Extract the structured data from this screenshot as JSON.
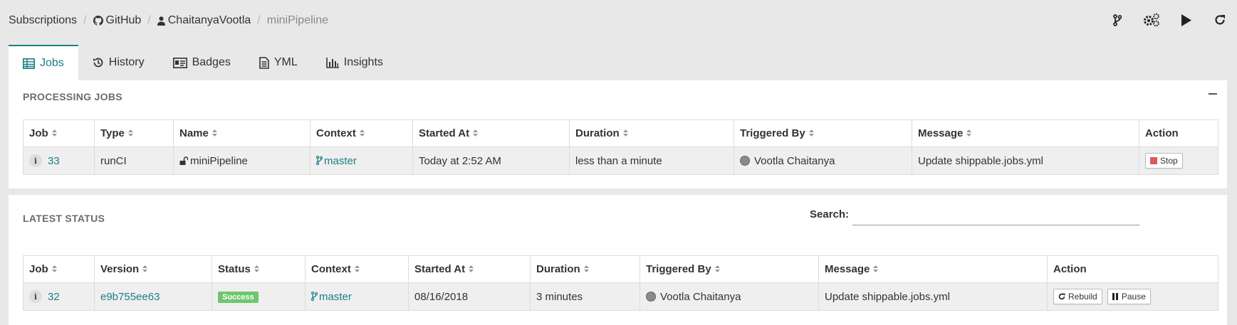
{
  "breadcrumb": {
    "items": [
      "Subscriptions",
      "GitHub",
      "ChaitanyaVootla",
      "miniPipeline"
    ],
    "separator": "/"
  },
  "top_actions": [
    "branch-icon",
    "settings-icon",
    "play-icon",
    "refresh-icon"
  ],
  "tabs": [
    {
      "label": "Jobs",
      "icon": "table-icon",
      "active": true
    },
    {
      "label": "History",
      "icon": "history-icon"
    },
    {
      "label": "Badges",
      "icon": "id-card-icon"
    },
    {
      "label": "YML",
      "icon": "file-icon"
    },
    {
      "label": "Insights",
      "icon": "bar-chart-icon"
    }
  ],
  "processing": {
    "title": "PROCESSING JOBS",
    "columns": [
      "Job",
      "Type",
      "Name",
      "Context",
      "Started At",
      "Duration",
      "Triggered By",
      "Message",
      "Action"
    ],
    "rows": [
      {
        "job": "33",
        "type": "runCI",
        "name": "miniPipeline",
        "context": "master",
        "started_at": "Today at 2:52 AM",
        "duration": "less than a minute",
        "triggered_by": "Vootla Chaitanya",
        "message": "Update shippable.jobs.yml",
        "action": "Stop"
      }
    ]
  },
  "latest": {
    "title": "LATEST STATUS",
    "search_label": "Search:",
    "search_value": "",
    "columns": [
      "Job",
      "Version",
      "Status",
      "Context",
      "Started At",
      "Duration",
      "Triggered By",
      "Message",
      "Action"
    ],
    "rows": [
      {
        "job": "32",
        "version": "e9b755ee63",
        "status": "Success",
        "context": "master",
        "started_at": "08/16/2018",
        "duration": "3 minutes",
        "triggered_by": "Vootla Chaitanya",
        "message": "Update shippable.jobs.yml",
        "actions": [
          "Rebuild",
          "Pause"
        ]
      }
    ]
  },
  "colors": {
    "accent": "#1a7f86",
    "success": "#6ec76c",
    "stop": "#e0595a"
  }
}
